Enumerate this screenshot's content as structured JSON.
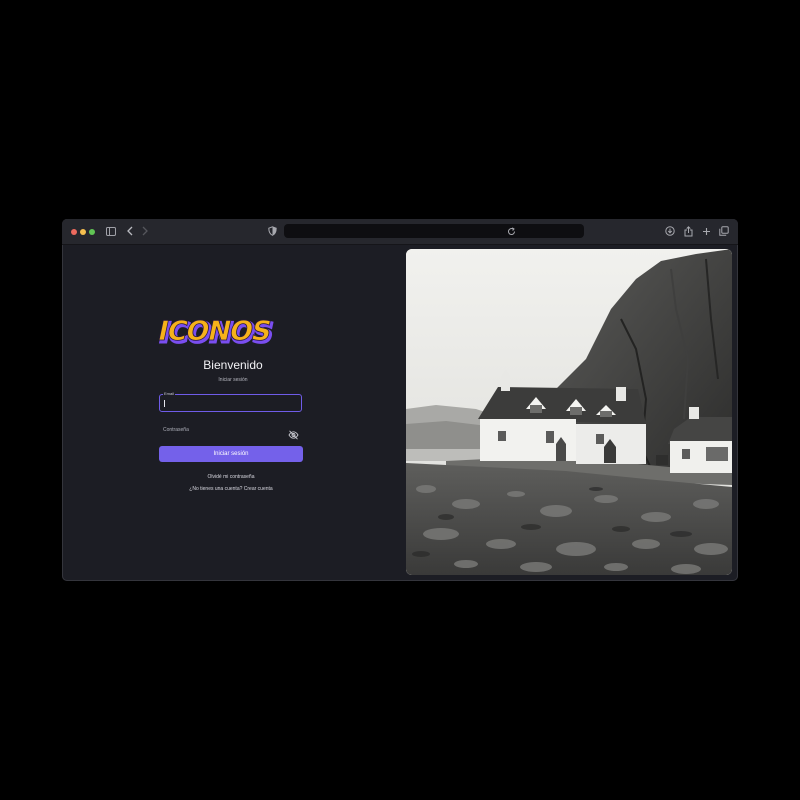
{
  "browser": {
    "icons": {
      "sidebar": "sidebar-icon",
      "back": "chevron-left-icon",
      "forward": "chevron-right-icon",
      "privacy": "shield-icon",
      "reload": "reload-icon",
      "download": "download-icon",
      "share": "share-icon",
      "new_tab": "plus-icon",
      "tabs": "tabs-overview-icon"
    },
    "url": ""
  },
  "login": {
    "logo_text": "ICONOS",
    "title": "Bienvenido",
    "subtitle": "Iniciar sesión",
    "email": {
      "label": "Email",
      "value": ""
    },
    "password": {
      "placeholder": "Contraseña",
      "toggle_icon": "eye-off-icon"
    },
    "submit_label": "Iniciar sesión",
    "forgot_link": "Olvidé mi contraseña",
    "signup_link": "¿No tienes una cuenta? Crear cuenta"
  },
  "colors": {
    "accent": "#7461ea",
    "background": "#1c1d24",
    "logo_fill": "#f6b21a",
    "logo_shadow": "#7a4ef0"
  }
}
